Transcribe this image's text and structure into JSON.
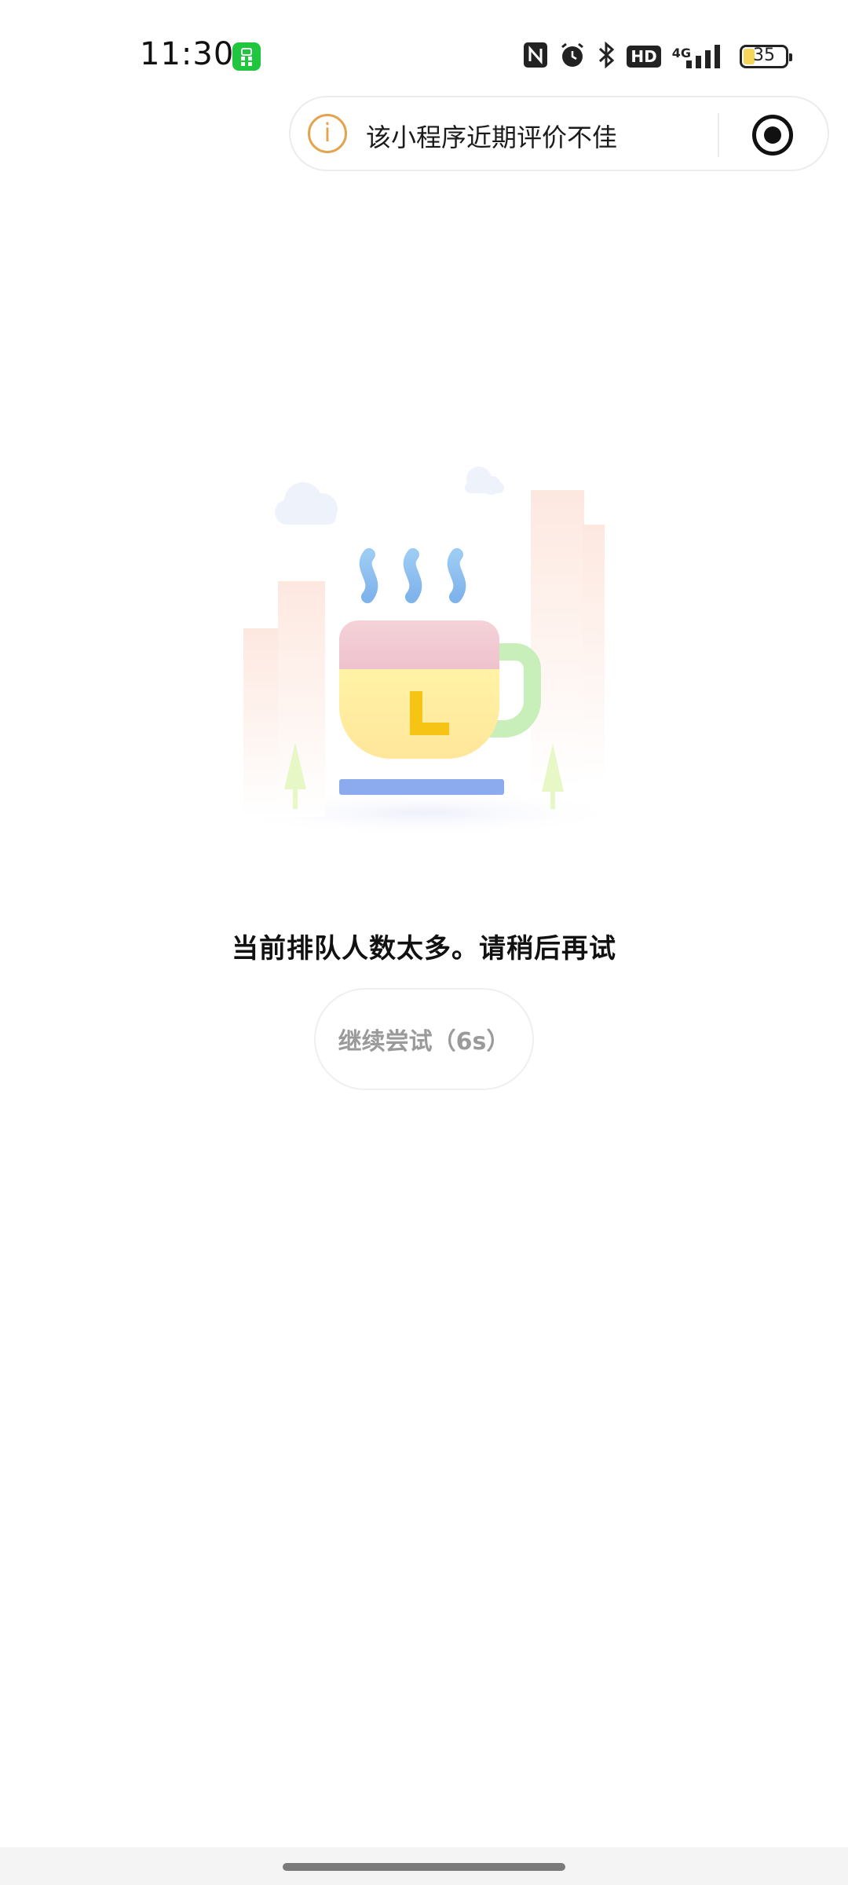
{
  "status_bar": {
    "time": "11:30",
    "network": "4G",
    "hd": "HD",
    "battery": "35",
    "icons": [
      "app-badge-icon",
      "nfc-icon",
      "alarm-icon",
      "bluetooth-icon",
      "hd-icon",
      "signal-icon",
      "battery-icon"
    ]
  },
  "capsule": {
    "info_icon": "i",
    "text": "该小程序近期评价不佳"
  },
  "main": {
    "message": "当前排队人数太多。请稍后再试",
    "retry_label": "继续尝试（6s）"
  },
  "colors": {
    "accent_warning": "#e3a34f",
    "cup_body": "#fff0a6",
    "cup_top": "#f1c3cf",
    "cup_handle": "#c9efbc",
    "clock_hand": "#f5c513",
    "saucer": "#8fb0ef",
    "steam": "#8cc0f0"
  }
}
